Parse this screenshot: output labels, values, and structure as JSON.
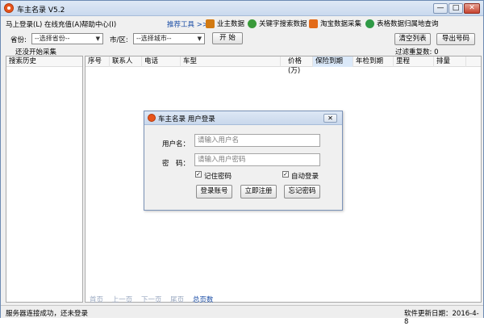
{
  "window": {
    "title": "车主名录 V5.2",
    "min": "—",
    "max": "□",
    "close": "✕"
  },
  "menu": {
    "items": [
      "马上登录(L)",
      "在线充值(A)",
      "帮助中心(I)"
    ],
    "tools_label": "推荐工具 >>",
    "tools": [
      {
        "label": "业主数据",
        "icon": "house-icon",
        "color": "#d27a12"
      },
      {
        "label": "关键字搜索数据",
        "icon": "search-icon",
        "color": "#3a9a3a"
      },
      {
        "label": "淘宝数据采集",
        "icon": "taobao-icon",
        "color": "#e36b1a"
      },
      {
        "label": "表格数据归属地查询",
        "icon": "table-icon",
        "color": "#2f9a46"
      }
    ]
  },
  "filters": {
    "province_label": "省份:",
    "province_value": "--选择省份--",
    "city_label": "市/区:",
    "city_value": "--选择城市--",
    "start_button": "开 始",
    "clear_button": "清空列表",
    "export_button": "导出号码",
    "status": "还没开始采集",
    "dedupe": "过滤重复数: 0"
  },
  "left_panel": {
    "header": "搜索历史"
  },
  "grid": {
    "columns": [
      "序号",
      "联系人",
      "电话",
      "车型",
      "价格(万)",
      "保险到期",
      "年检到期",
      "里程",
      "排量"
    ]
  },
  "pager": {
    "items": [
      "首页",
      "上一页",
      "下一页",
      "尾页"
    ],
    "total": "总页数"
  },
  "statusbar": {
    "left": "服务器连接成功，还未登录",
    "right": "软件更新日期：2016-4-8"
  },
  "login": {
    "title": "车主名录 用户登录",
    "close": "✕",
    "username_label": "用户名：",
    "username_placeholder": "请输入用户名",
    "password_label": "密　码：",
    "password_placeholder": "请输入用户密码",
    "remember_label": "记住密码",
    "remember_checked": true,
    "auto_label": "自动登录",
    "auto_checked": true,
    "login_button": "登录账号",
    "register_button": "立即注册",
    "forgot_button": "忘记密码"
  }
}
